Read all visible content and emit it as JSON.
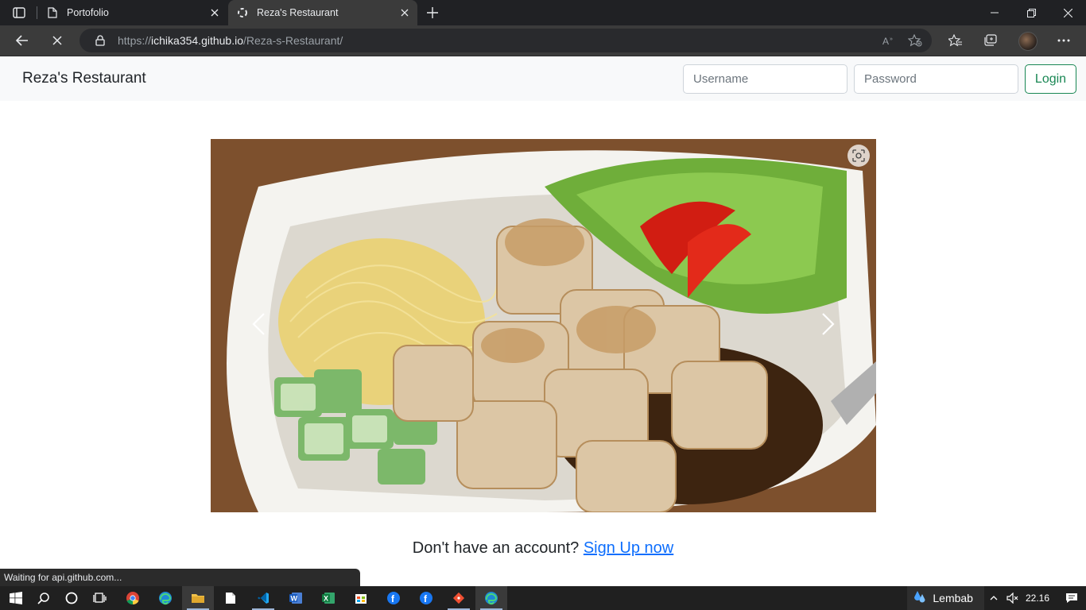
{
  "browser": {
    "tabs": [
      {
        "title": "Portofolio",
        "active": false
      },
      {
        "title": "Reza's Restaurant",
        "active": true
      }
    ],
    "url_prefix": "https://",
    "url_host": "ichika354.github.io",
    "url_path": "/Reza-s-Restaurant/"
  },
  "navbar": {
    "brand": "Reza's Restaurant",
    "username_placeholder": "Username",
    "password_placeholder": "Password",
    "login_label": "Login"
  },
  "main": {
    "signup_prompt": "Don't have an account?",
    "signup_link": "Sign Up now"
  },
  "status_bar": "Waiting for api.github.com...",
  "taskbar": {
    "weather_label": "Lembab",
    "clock": "22.16"
  },
  "colors": {
    "login_border": "#198754",
    "link": "#0d6efd",
    "navbar_bg": "#f8f9fa"
  }
}
